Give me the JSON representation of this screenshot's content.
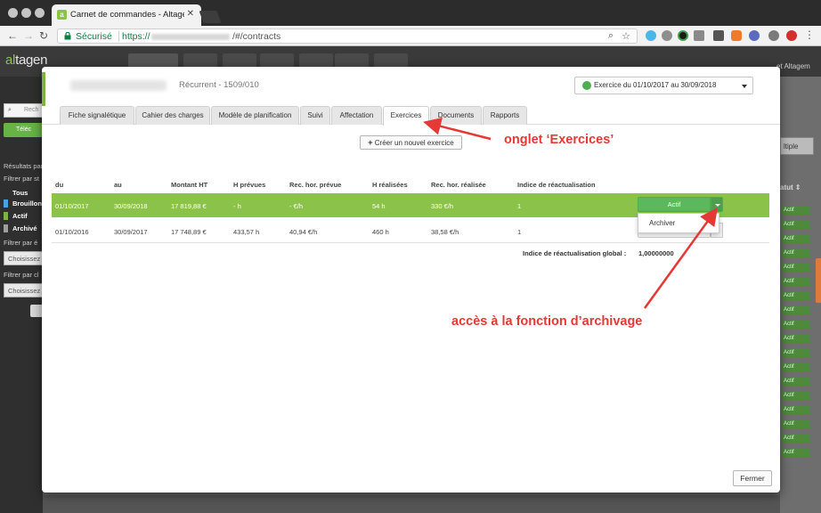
{
  "browser": {
    "tab_title": "Carnet de commandes - Altagen",
    "secure_label": "Sécurisé",
    "url_scheme": "https://",
    "url_path": "/#/contracts"
  },
  "app": {
    "logo_prefix": "al",
    "logo_suffix": "tagen",
    "user_label": "et Altagem"
  },
  "sidebar": {
    "search_placeholder": "Rech",
    "green_button": "Téléc",
    "results_label": "Résultats par",
    "filter_status_label": "Filtrer par st",
    "status_items": [
      {
        "label": "Tous",
        "color": ""
      },
      {
        "label": "Brouillon",
        "color": "#4aa3df"
      },
      {
        "label": "Actif",
        "color": "#7cb342"
      },
      {
        "label": "Archivé",
        "color": "#9e9e9e"
      }
    ],
    "filter_2_label": "Filtrer par é",
    "select_1": "Choisissez",
    "filter_3_label": "Filtrer par cl",
    "select_2": "Choisissez"
  },
  "background_right": {
    "button_label": "ltiple",
    "column_header": "atut ⇕",
    "badge_label": "Actif"
  },
  "modal": {
    "contract_ref": "Récurrent - 1509/010",
    "period_label": "Exercice du 01/10/2017 au 30/09/2018",
    "tabs": [
      "Fiche signalétique",
      "Cahier des charges",
      "Modèle de planification",
      "Suivi",
      "Affectation",
      "Exercices",
      "Documents",
      "Rapports"
    ],
    "active_tab": "Exercices",
    "new_exercise_button": "Créer un nouvel exercice",
    "table": {
      "headers": [
        "du",
        "au",
        "Montant HT",
        "H prévues",
        "Rec. hor. prévue",
        "H réalisées",
        "Rec. hor. réalisée",
        "Indice de réactualisation"
      ],
      "rows": [
        [
          "01/10/2017",
          "30/09/2018",
          "17 819,88 €",
          "- h",
          "- €/h",
          "54 h",
          "330 €/h",
          "1"
        ],
        [
          "01/10/2016",
          "30/09/2017",
          "17 748,89 €",
          "433,57 h",
          "40,94 €/h",
          "460 h",
          "38,58 €/h",
          "1"
        ]
      ],
      "status_label": "Actif",
      "dropdown_item": "Archiver"
    },
    "global_index_label": "Indice de réactualisation global :",
    "global_index_value": "1,00000000",
    "close_button": "Fermer"
  },
  "annotations": {
    "tab_note": "onglet ‘Exercices’",
    "archive_note": "accès à la fonction d’archivage",
    "color": "#e53935"
  }
}
